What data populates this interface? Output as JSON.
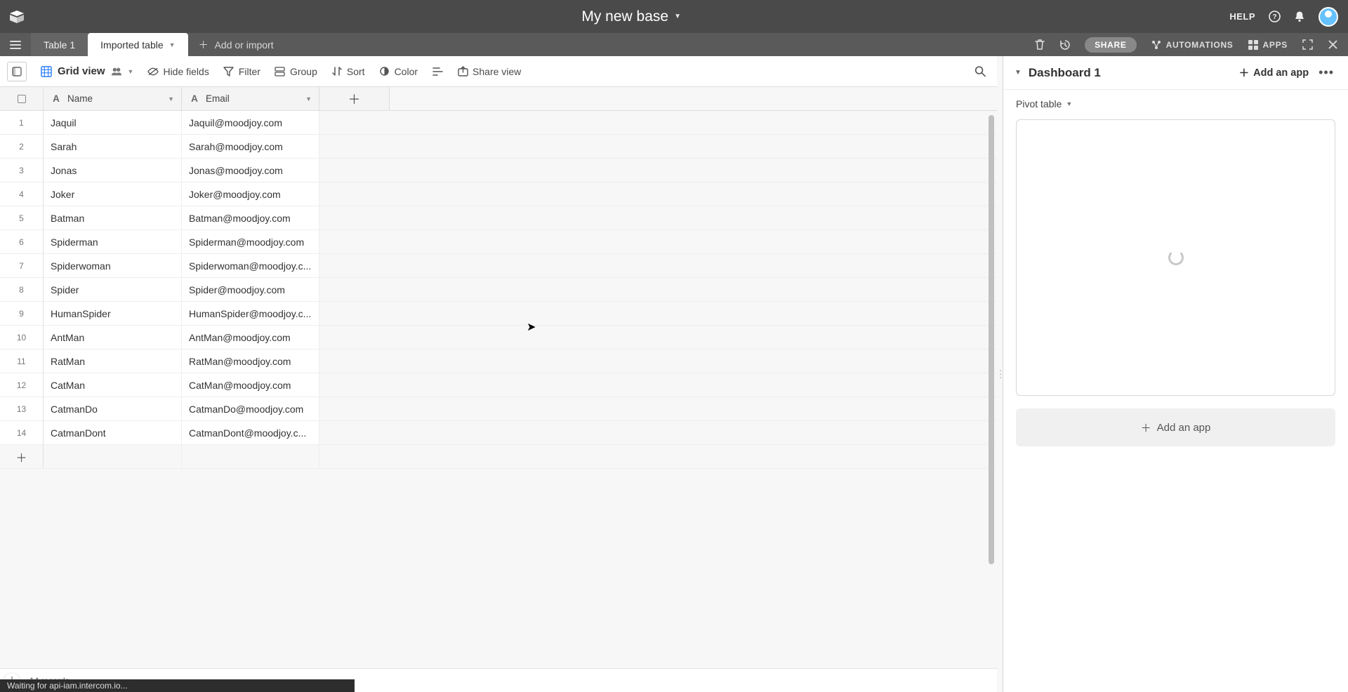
{
  "base_title": "My new base",
  "help_label": "HELP",
  "tabs": {
    "inactive": "Table 1",
    "active": "Imported table",
    "add_import": "Add or import"
  },
  "tab_right": {
    "share": "SHARE",
    "automations": "AUTOMATIONS",
    "apps": "APPS"
  },
  "view_toolbar": {
    "grid_view": "Grid view",
    "hide_fields": "Hide fields",
    "filter": "Filter",
    "group": "Group",
    "sort": "Sort",
    "color": "Color",
    "share_view": "Share view"
  },
  "columns": {
    "name": "Name",
    "email": "Email"
  },
  "rows": [
    {
      "n": "1",
      "name": "Jaquil",
      "email": "Jaquil@moodjoy.com"
    },
    {
      "n": "2",
      "name": "Sarah",
      "email": "Sarah@moodjoy.com"
    },
    {
      "n": "3",
      "name": "Jonas",
      "email": "Jonas@moodjoy.com"
    },
    {
      "n": "4",
      "name": "Joker",
      "email": "Joker@moodjoy.com"
    },
    {
      "n": "5",
      "name": "Batman",
      "email": "Batman@moodjoy.com"
    },
    {
      "n": "6",
      "name": "Spiderman",
      "email": "Spiderman@moodjoy.com"
    },
    {
      "n": "7",
      "name": "Spiderwoman",
      "email": "Spiderwoman@moodjoy.c..."
    },
    {
      "n": "8",
      "name": "Spider",
      "email": "Spider@moodjoy.com"
    },
    {
      "n": "9",
      "name": "HumanSpider",
      "email": "HumanSpider@moodjoy.c..."
    },
    {
      "n": "10",
      "name": "AntMan",
      "email": "AntMan@moodjoy.com"
    },
    {
      "n": "11",
      "name": "RatMan",
      "email": "RatMan@moodjoy.com"
    },
    {
      "n": "12",
      "name": "CatMan",
      "email": "CatMan@moodjoy.com"
    },
    {
      "n": "13",
      "name": "CatmanDo",
      "email": "CatmanDo@moodjoy.com"
    },
    {
      "n": "14",
      "name": "CatmanDont",
      "email": "CatmanDont@moodjoy.c..."
    }
  ],
  "footer": {
    "record_count": "14 records"
  },
  "status_toast": "Waiting for api-iam.intercom.io...",
  "dashboard": {
    "title": "Dashboard 1",
    "add_app": "Add an app",
    "pivot_label": "Pivot table",
    "add_app_block": "Add an app"
  }
}
